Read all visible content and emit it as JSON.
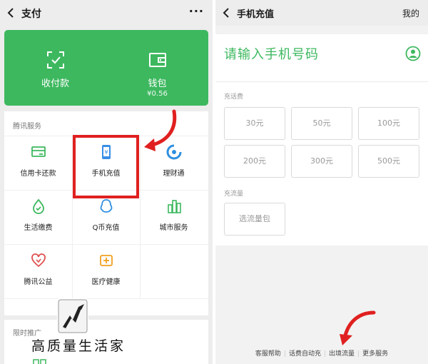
{
  "left_screen": {
    "header": {
      "title": "支付",
      "more": "···"
    },
    "wallet_card": {
      "pay_label": "收付款",
      "wallet_label": "钱包",
      "wallet_balance": "¥0.56"
    },
    "services": {
      "title": "腾讯服务",
      "items": [
        {
          "label": "信用卡还款",
          "icon": "credit-card-icon"
        },
        {
          "label": "手机充值",
          "icon": "phone-recharge-icon"
        },
        {
          "label": "理财通",
          "icon": "wealth-icon"
        },
        {
          "label": "生活缴费",
          "icon": "utility-icon"
        },
        {
          "label": "Q币充值",
          "icon": "qq-coin-icon"
        },
        {
          "label": "城市服务",
          "icon": "city-icon"
        },
        {
          "label": "腾讯公益",
          "icon": "charity-icon"
        },
        {
          "label": "医疗健康",
          "icon": "health-icon"
        }
      ]
    },
    "promo": {
      "title": "限时推广"
    },
    "watermark": "高质量生活家",
    "colors": {
      "green": "#3db85f",
      "highlight": "#e02020"
    }
  },
  "right_screen": {
    "header": {
      "title": "手机充值",
      "mine": "我的"
    },
    "phone_placeholder": "请输入手机号码",
    "charge_label": "充话费",
    "charge_amounts": [
      "30元",
      "50元",
      "100元",
      "200元",
      "300元",
      "500元"
    ],
    "data_label": "充流量",
    "data_button": "选流量包",
    "footer_links": [
      "客服帮助",
      "话费自动充",
      "出境流量",
      "更多服务"
    ]
  }
}
